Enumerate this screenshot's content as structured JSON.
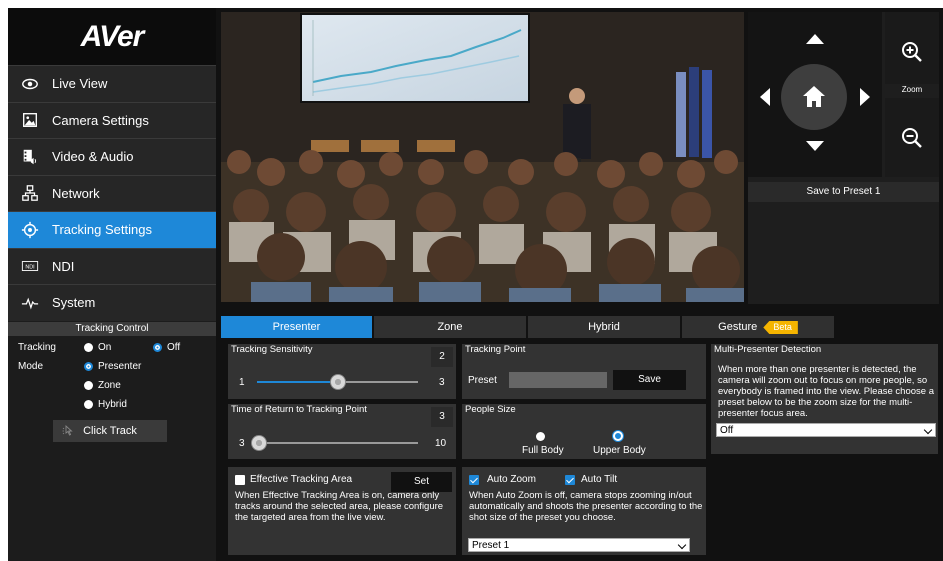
{
  "brand": {
    "logo_text": "AVer"
  },
  "sidebar": {
    "items": [
      {
        "label": "Live View",
        "icon": "eye-icon",
        "active": false
      },
      {
        "label": "Camera Settings",
        "icon": "picture-icon",
        "active": false
      },
      {
        "label": "Video & Audio",
        "icon": "film-speaker-icon",
        "active": false
      },
      {
        "label": "Network",
        "icon": "network-icon",
        "active": false
      },
      {
        "label": "Tracking Settings",
        "icon": "target-icon",
        "active": true
      },
      {
        "label": "NDI",
        "icon": "ndi-icon",
        "active": false
      },
      {
        "label": "System",
        "icon": "pulse-icon",
        "active": false
      }
    ]
  },
  "tracking_control": {
    "title": "Tracking Control",
    "tracking_label": "Tracking",
    "tracking_on": "On",
    "tracking_off": "Off",
    "tracking_selected": "Off",
    "mode_label": "Mode",
    "mode_options": [
      "Presenter",
      "Zone",
      "Hybrid"
    ],
    "mode_selected": "Presenter",
    "click_track_label": "Click Track"
  },
  "ptz": {
    "zoom_label": "Zoom",
    "save_preset_label": "Save to Preset 1"
  },
  "tabs": [
    {
      "label": "Presenter",
      "active": true
    },
    {
      "label": "Zone",
      "active": false
    },
    {
      "label": "Hybrid",
      "active": false
    },
    {
      "label": "Gesture",
      "active": false,
      "badge": "Beta"
    }
  ],
  "presenter": {
    "sensitivity": {
      "title": "Tracking Sensitivity",
      "value": "2",
      "min": "1",
      "max": "3",
      "level": 2
    },
    "return_time": {
      "title": "Time of Return to Tracking Point",
      "value": "3",
      "min": "3",
      "max": "10",
      "level": 3
    },
    "tracking_point": {
      "title": "Tracking Point",
      "preset_label": "Preset",
      "save_label": "Save"
    },
    "people_size": {
      "title": "People Size",
      "options": [
        "Full Body",
        "Upper Body"
      ],
      "selected": "Upper Body"
    },
    "effective_area": {
      "checkbox_label": "Effective Tracking Area",
      "checked": false,
      "set_label": "Set",
      "description": "When Effective Tracking Area is on, camera only tracks around the selected area, please configure the targeted area from the live view."
    },
    "auto": {
      "auto_zoom_label": "Auto Zoom",
      "auto_zoom_checked": true,
      "auto_tilt_label": "Auto Tilt",
      "auto_tilt_checked": true,
      "description": "When Auto Zoom is off, camera stops zooming in/out automatically and shoots the presenter according to the shot size of the preset you choose.",
      "preset_select": "Preset 1"
    },
    "multi_presenter": {
      "title": "Multi-Presenter Detection",
      "description": "When more than one presenter is detected, the camera will zoom out to focus on more people, so everybody is framed into the view. Please choose a preset below to be the zoom size for the multi-presenter focus area.",
      "select_value": "Off"
    }
  },
  "colors": {
    "accent": "#1e88d8",
    "beta": "#f5b400"
  }
}
